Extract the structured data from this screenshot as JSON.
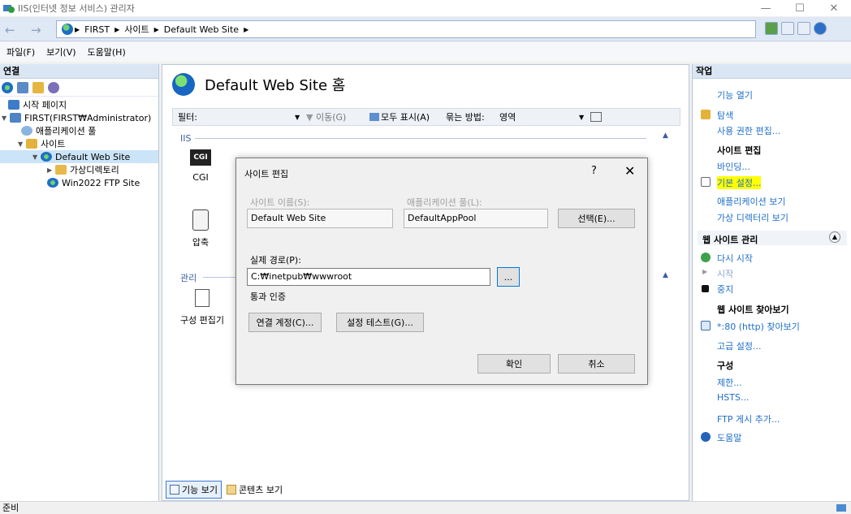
{
  "window": {
    "title": "IIS(인터넷 정보 서비스) 관리자",
    "minimize": "—",
    "maximize": "☐",
    "close": "✕"
  },
  "address": {
    "back": "←",
    "forward": "→",
    "crumbs": [
      "FIRST",
      "사이트",
      "Default Web Site"
    ]
  },
  "menu": [
    "파일(F)",
    "보기(V)",
    "도움말(H)"
  ],
  "connections": {
    "header": "연결",
    "tree": [
      "시작 페이지",
      "FIRST(FIRST₩Administrator)",
      "애플리케이션 풀",
      "사이트",
      "Default Web Site",
      "가상디렉토리",
      "Win2022 FTP Site"
    ]
  },
  "center": {
    "title": "Default Web Site 홈",
    "filter_label": "필터:",
    "filter_go": "이동(G)",
    "show_all": "모두 표시(A)",
    "group_by_label": "묶는 방법:",
    "group_by_value": "영역",
    "section_iis": "IIS",
    "section_manage": "관리",
    "cgi_badge": "CGI",
    "icon_cgi": "CGI",
    "icon_compress": "압축",
    "icon_config": "구성 편집기",
    "tab_features": "기능 보기",
    "tab_content": "콘텐츠 보기"
  },
  "actions": {
    "header": "작업",
    "open_feature": "기능 열기",
    "explore": "탐색",
    "edit_permissions": "사용 권한 편집...",
    "site_edit_header": "사이트 편집",
    "bindings": "바인딩...",
    "basic_settings": "기본 설정...",
    "view_apps": "애플리케이션 보기",
    "view_vdirs": "가상 디렉터리 보기",
    "manage_header": "웹 사이트 관리",
    "restart": "다시 시작",
    "start": "시작",
    "stop": "중지",
    "browse_header": "웹 사이트 찾아보기",
    "browse_80": "*:80 (http) 찾아보기",
    "advanced": "고급 설정...",
    "config_header": "구성",
    "limits": "제한...",
    "hsts": "HSTS...",
    "ftp_add": "FTP 게시 추가...",
    "help": "도움말"
  },
  "dialog": {
    "title": "사이트 편집",
    "help": "?",
    "close": "✕",
    "site_name_label": "사이트 이름(S):",
    "site_name_value": "Default Web Site",
    "app_pool_label": "애플리케이션 풀(L):",
    "app_pool_value": "DefaultAppPool",
    "select_button": "선택(E)...",
    "physical_path_label": "실제 경로(P):",
    "physical_path_value": "C:₩inetpub₩wwwroot",
    "browse_button": "...",
    "pass_through_label": "통과 인증",
    "connect_as_button": "연결 계정(C)...",
    "test_settings_button": "설정 테스트(G)...",
    "ok_button": "확인",
    "cancel_button": "취소"
  },
  "status": {
    "text": "준비"
  },
  "colors": {
    "link": "#1e6fc9",
    "highlight": "#ffff00",
    "selection": "#cce4f7"
  }
}
